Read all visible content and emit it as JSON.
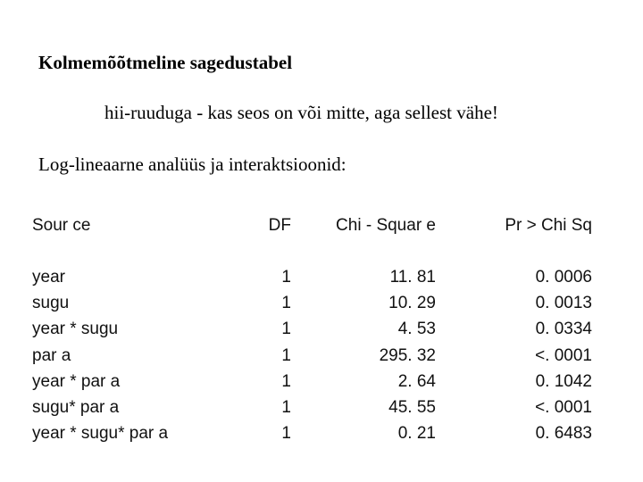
{
  "title": "Kolmemõõtmeline sagedustabel",
  "subtitle": "hii-ruuduga - kas seos on või mitte, aga sellest vähe!",
  "section_heading": "Log-lineaarne analüüs ja interaktsioonid:",
  "table": {
    "headers": [
      "Sour ce",
      "DF",
      "Chi - Squar e",
      "Pr  >  Chi Sq"
    ],
    "rows": [
      {
        "source": "year",
        "df": "1",
        "chi": "11. 81",
        "pr": "0. 0006"
      },
      {
        "source": "sugu",
        "df": "1",
        "chi": "10. 29",
        "pr": "0. 0013"
      },
      {
        "source": "year * sugu",
        "df": "1",
        "chi": "4. 53",
        "pr": "0. 0334"
      },
      {
        "source": "par a",
        "df": "1",
        "chi": "295. 32",
        "pr": "<. 0001"
      },
      {
        "source": "year * par a",
        "df": "1",
        "chi": "2. 64",
        "pr": "0. 1042"
      },
      {
        "source": "sugu* par a",
        "df": "1",
        "chi": "45. 55",
        "pr": "<. 0001"
      },
      {
        "source": "year * sugu* par a",
        "df": "1",
        "chi": "0. 21",
        "pr": "0. 6483"
      }
    ]
  }
}
